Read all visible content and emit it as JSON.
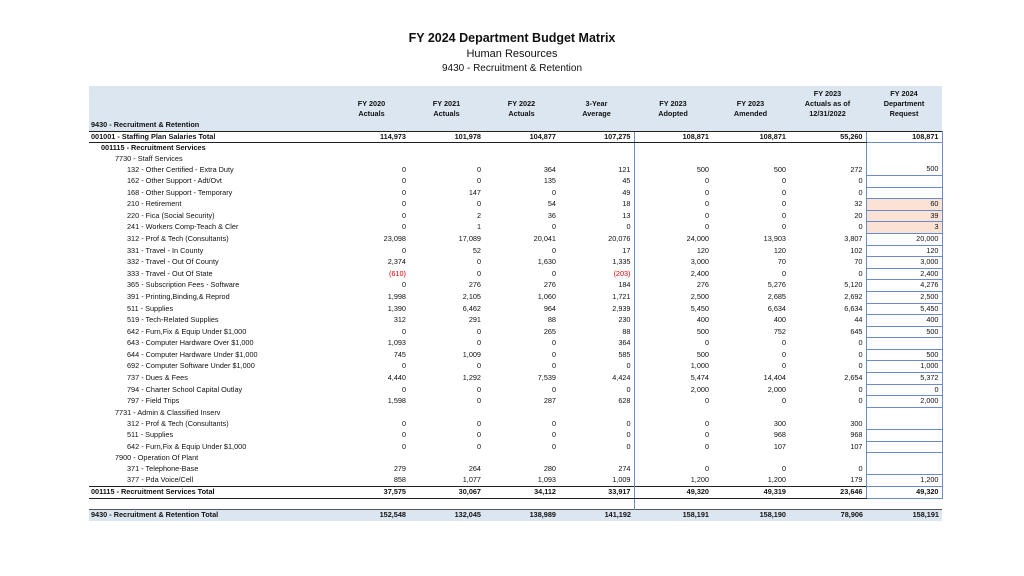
{
  "header": {
    "title": "FY 2024 Department Budget Matrix",
    "department": "Human Resources",
    "unit": "9430 - Recruitment & Retention"
  },
  "columns": [
    {
      "label": "FY 2020\nActuals"
    },
    {
      "label": "FY 2021\nActuals"
    },
    {
      "label": "FY 2022\nActuals"
    },
    {
      "label": "3-Year\nAverage"
    },
    {
      "label": "FY 2023\nAdopted"
    },
    {
      "label": "FY 2023\nAmended"
    },
    {
      "label": "FY 2023\nActuals as of\n12/31/2022"
    },
    {
      "label": "FY 2024\nDepartment\nRequest"
    }
  ],
  "rows": [
    {
      "type": "group",
      "label": "9430 - Recruitment & Retention",
      "values": [
        "",
        "",
        "",
        "",
        "",
        "",
        "",
        ""
      ]
    },
    {
      "type": "total",
      "label": "001001 - Staffing Plan Salaries Total",
      "values": [
        "114,973",
        "101,978",
        "104,877",
        "107,275",
        "108,871",
        "108,871",
        "55,260",
        "108,871"
      ]
    },
    {
      "type": "sub",
      "label": "001115 - Recruitment Services",
      "values": [
        "",
        "",
        "",
        "",
        "",
        "",
        "",
        ""
      ]
    },
    {
      "type": "section",
      "label": "7730 - Staff Services",
      "values": [
        "",
        "",
        "",
        "",
        "",
        "",
        "",
        ""
      ]
    },
    {
      "type": "item",
      "label": "132 - Other Certified - Extra Duty",
      "values": [
        "0",
        "0",
        "364",
        "121",
        "500",
        "500",
        "272",
        "500"
      ]
    },
    {
      "type": "item",
      "label": "162 - Other Support - Adt/Ovt",
      "values": [
        "0",
        "0",
        "135",
        "45",
        "0",
        "0",
        "0",
        ""
      ]
    },
    {
      "type": "item",
      "label": "168 - Other Support - Temporary",
      "values": [
        "0",
        "147",
        "0",
        "49",
        "0",
        "0",
        "0",
        ""
      ]
    },
    {
      "type": "item",
      "label": "210 - Retirement",
      "values": [
        "0",
        "0",
        "54",
        "18",
        "0",
        "0",
        "32",
        "60"
      ],
      "peach": true
    },
    {
      "type": "item",
      "label": "220 - Fica (Social Security)",
      "values": [
        "0",
        "2",
        "36",
        "13",
        "0",
        "0",
        "20",
        "39"
      ],
      "peach": true
    },
    {
      "type": "item",
      "label": "241 - Workers Comp-Teach & Cler",
      "values": [
        "0",
        "1",
        "0",
        "0",
        "0",
        "0",
        "0",
        "3"
      ],
      "peach": true
    },
    {
      "type": "item",
      "label": "312 - Prof & Tech (Consultants)",
      "values": [
        "23,098",
        "17,089",
        "20,041",
        "20,076",
        "24,000",
        "13,903",
        "3,807",
        "20,000"
      ]
    },
    {
      "type": "item",
      "label": "331 - Travel - In County",
      "values": [
        "0",
        "52",
        "0",
        "17",
        "120",
        "120",
        "102",
        "120"
      ]
    },
    {
      "type": "item",
      "label": "332 - Travel - Out Of County",
      "values": [
        "2,374",
        "0",
        "1,630",
        "1,335",
        "3,000",
        "70",
        "70",
        "3,000"
      ]
    },
    {
      "type": "item",
      "label": "333 - Travel - Out Of State",
      "values": [
        "(610)",
        "0",
        "0",
        "(203)",
        "2,400",
        "0",
        "0",
        "2,400"
      ],
      "red": [
        0,
        3
      ]
    },
    {
      "type": "item",
      "label": "365 - Subscription Fees - Software",
      "values": [
        "0",
        "276",
        "276",
        "184",
        "276",
        "5,276",
        "5,120",
        "4,276"
      ]
    },
    {
      "type": "item",
      "label": "391 - Printing,Binding,& Reprod",
      "values": [
        "1,998",
        "2,105",
        "1,060",
        "1,721",
        "2,500",
        "2,685",
        "2,692",
        "2,500"
      ]
    },
    {
      "type": "item",
      "label": "511 - Supplies",
      "values": [
        "1,390",
        "6,462",
        "964",
        "2,939",
        "5,450",
        "6,634",
        "6,634",
        "5,450"
      ]
    },
    {
      "type": "item",
      "label": "519 - Tech-Related Supplies",
      "values": [
        "312",
        "291",
        "88",
        "230",
        "400",
        "400",
        "44",
        "400"
      ]
    },
    {
      "type": "item",
      "label": "642 - Furn,Fix & Equip Under $1,000",
      "values": [
        "0",
        "0",
        "265",
        "88",
        "500",
        "752",
        "645",
        "500"
      ]
    },
    {
      "type": "item",
      "label": "643 - Computer Hardware Over $1,000",
      "values": [
        "1,093",
        "0",
        "0",
        "364",
        "0",
        "0",
        "0",
        ""
      ]
    },
    {
      "type": "item",
      "label": "644 - Computer Hardware Under $1,000",
      "values": [
        "745",
        "1,009",
        "0",
        "585",
        "500",
        "0",
        "0",
        "500"
      ]
    },
    {
      "type": "item",
      "label": "692 - Computer Software Under $1,000",
      "values": [
        "0",
        "0",
        "0",
        "0",
        "1,000",
        "0",
        "0",
        "1,000"
      ]
    },
    {
      "type": "item",
      "label": "737 - Dues & Fees",
      "values": [
        "4,440",
        "1,292",
        "7,539",
        "4,424",
        "5,474",
        "14,404",
        "2,654",
        "5,372"
      ]
    },
    {
      "type": "item",
      "label": "794 - Charter School Capital Outlay",
      "values": [
        "0",
        "0",
        "0",
        "0",
        "2,000",
        "2,000",
        "0",
        "0"
      ]
    },
    {
      "type": "item",
      "label": "797 - Field Trips",
      "values": [
        "1,598",
        "0",
        "287",
        "628",
        "0",
        "0",
        "0",
        "2,000"
      ]
    },
    {
      "type": "section",
      "label": "7731 - Admin & Classified Inserv",
      "values": [
        "",
        "",
        "",
        "",
        "",
        "",
        "",
        ""
      ]
    },
    {
      "type": "item",
      "label": "312 - Prof & Tech (Consultants)",
      "values": [
        "0",
        "0",
        "0",
        "0",
        "0",
        "300",
        "300",
        ""
      ]
    },
    {
      "type": "item",
      "label": "511 - Supplies",
      "values": [
        "0",
        "0",
        "0",
        "0",
        "0",
        "968",
        "968",
        ""
      ]
    },
    {
      "type": "item",
      "label": "642 - Furn,Fix & Equip Under $1,000",
      "values": [
        "0",
        "0",
        "0",
        "0",
        "0",
        "107",
        "107",
        ""
      ]
    },
    {
      "type": "section",
      "label": "7900 - Operation Of Plant",
      "values": [
        "",
        "",
        "",
        "",
        "",
        "",
        "",
        ""
      ]
    },
    {
      "type": "item",
      "label": "371 - Telephone-Base",
      "values": [
        "279",
        "264",
        "280",
        "274",
        "0",
        "0",
        "0",
        ""
      ]
    },
    {
      "type": "item",
      "label": "377 - Pda Voice/Cell",
      "values": [
        "858",
        "1,077",
        "1,093",
        "1,009",
        "1,200",
        "1,200",
        "179",
        "1,200"
      ]
    },
    {
      "type": "total",
      "label": "001115 - Recruitment Services Total",
      "values": [
        "37,575",
        "30,067",
        "34,112",
        "33,917",
        "49,320",
        "49,319",
        "23,646",
        "49,320"
      ]
    },
    {
      "type": "spacer",
      "label": "",
      "values": [
        "",
        "",
        "",
        "",
        "",
        "",
        "",
        ""
      ]
    },
    {
      "type": "grand",
      "label": "9430 - Recruitment & Retention Total",
      "values": [
        "152,548",
        "132,045",
        "138,989",
        "141,192",
        "158,191",
        "158,190",
        "78,906",
        "158,191"
      ]
    }
  ]
}
